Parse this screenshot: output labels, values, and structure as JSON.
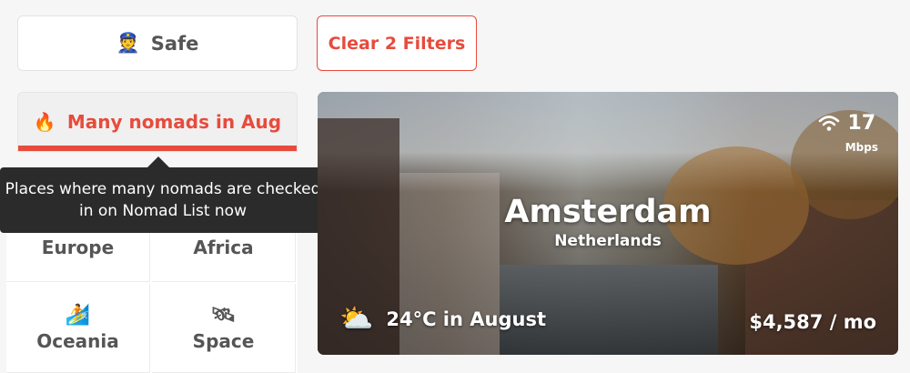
{
  "filters": {
    "safe": {
      "icon": "👮",
      "icon_name": "police-officer-icon",
      "label": "Safe"
    },
    "clear": {
      "label": "Clear 2 Filters"
    },
    "nomads": {
      "icon": "🔥",
      "icon_name": "fire-icon",
      "label": "Many nomads in Aug"
    }
  },
  "tooltip": {
    "line1": "Places where many nomads are checked",
    "line2": "in on Nomad List now"
  },
  "regions": [
    {
      "label": "Europe",
      "icon": "",
      "icon_name": ""
    },
    {
      "label": "Africa",
      "icon": "",
      "icon_name": ""
    },
    {
      "label": "Oceania",
      "icon": "🏄",
      "icon_name": "surfer-icon"
    },
    {
      "label": "Space",
      "icon": "🛰",
      "icon_name": "satellite-icon"
    }
  ],
  "card": {
    "city": "Amsterdam",
    "country": "Netherlands",
    "internet_speed": "17",
    "internet_unit": "Mbps",
    "weather_icon": "⛅",
    "weather_icon_name": "sun-behind-cloud-icon",
    "weather": "24°C in August",
    "cost": "$4,587 / mo"
  },
  "colors": {
    "accent": "#e74b3c",
    "tooltip_bg": "#2b2b2b",
    "background": "#f6f6f6"
  }
}
